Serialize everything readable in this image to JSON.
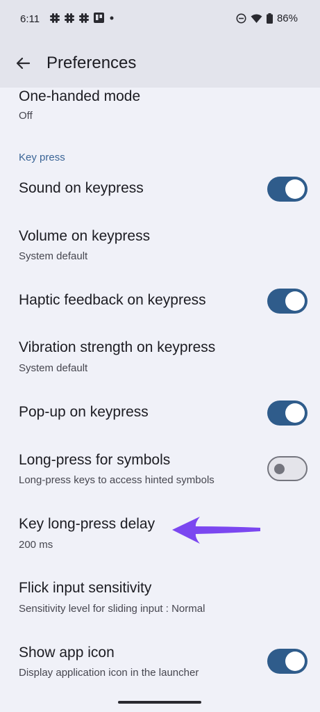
{
  "status_bar": {
    "time": "6:11",
    "battery": "86%",
    "left_icons": [
      "slack-icon",
      "slack-icon",
      "slack-icon",
      "trello-icon",
      "dot-icon"
    ],
    "right_icons": [
      "do-not-disturb-icon",
      "wifi-icon",
      "battery-icon"
    ]
  },
  "app_bar": {
    "title": "Preferences",
    "back_icon": "arrow-back-icon"
  },
  "colors": {
    "accent": "#2f5c8b",
    "section": "#3a6496",
    "background": "#f0f1f8",
    "annotation_arrow": "#7b47f0"
  },
  "items": [
    {
      "title": "One-handed mode",
      "subtitle": "Off"
    },
    {
      "section": "Key press"
    },
    {
      "title": "Sound on keypress",
      "toggle": true
    },
    {
      "title": "Volume on keypress",
      "subtitle": "System default"
    },
    {
      "title": "Haptic feedback on keypress",
      "toggle": true
    },
    {
      "title": "Vibration strength on keypress",
      "subtitle": "System default"
    },
    {
      "title": "Pop-up on keypress",
      "toggle": true
    },
    {
      "title": "Long-press for symbols",
      "subtitle": "Long-press keys to access hinted symbols",
      "toggle": false
    },
    {
      "title": "Key long-press delay",
      "subtitle": "200 ms"
    },
    {
      "title": "Flick input sensitivity",
      "subtitle": "Sensitivity level for sliding input : Normal"
    },
    {
      "title": "Show app icon",
      "subtitle": "Display application icon in the launcher",
      "toggle": true
    }
  ]
}
